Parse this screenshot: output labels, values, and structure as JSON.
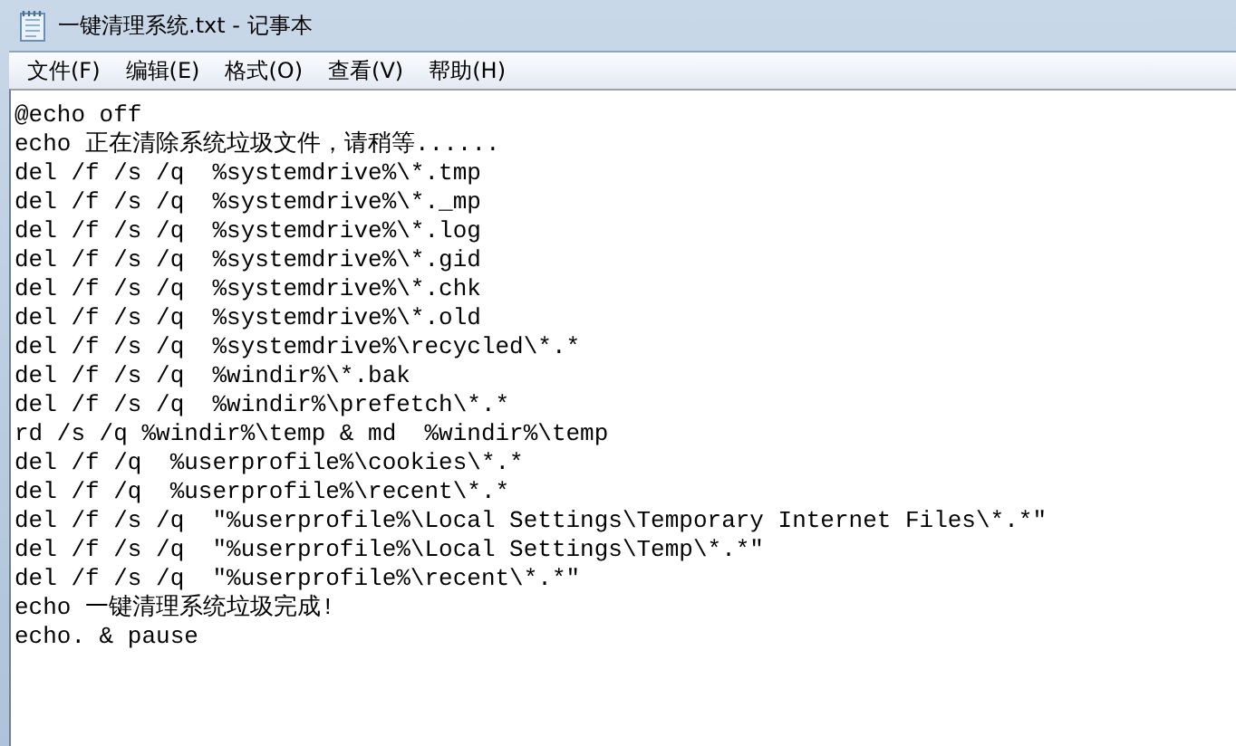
{
  "window": {
    "title": "一键清理系统.txt - 记事本"
  },
  "menu": [
    {
      "label": "文件(F)"
    },
    {
      "label": "编辑(E)"
    },
    {
      "label": "格式(O)"
    },
    {
      "label": "查看(V)"
    },
    {
      "label": "帮助(H)"
    }
  ],
  "editor": {
    "lines": [
      "@echo off",
      "echo 正在清除系统垃圾文件，请稍等......",
      "del /f /s /q  %systemdrive%\\*.tmp",
      "del /f /s /q  %systemdrive%\\*._mp",
      "del /f /s /q  %systemdrive%\\*.log",
      "del /f /s /q  %systemdrive%\\*.gid",
      "del /f /s /q  %systemdrive%\\*.chk",
      "del /f /s /q  %systemdrive%\\*.old",
      "del /f /s /q  %systemdrive%\\recycled\\*.*",
      "del /f /s /q  %windir%\\*.bak",
      "del /f /s /q  %windir%\\prefetch\\*.*",
      "rd /s /q %windir%\\temp & md  %windir%\\temp",
      "del /f /q  %userprofile%\\cookies\\*.*",
      "del /f /q  %userprofile%\\recent\\*.*",
      "del /f /s /q  \"%userprofile%\\Local Settings\\Temporary Internet Files\\*.*\"",
      "del /f /s /q  \"%userprofile%\\Local Settings\\Temp\\*.*\"",
      "del /f /s /q  \"%userprofile%\\recent\\*.*\"",
      "echo 一键清理系统垃圾完成!",
      "echo. & pause"
    ]
  }
}
